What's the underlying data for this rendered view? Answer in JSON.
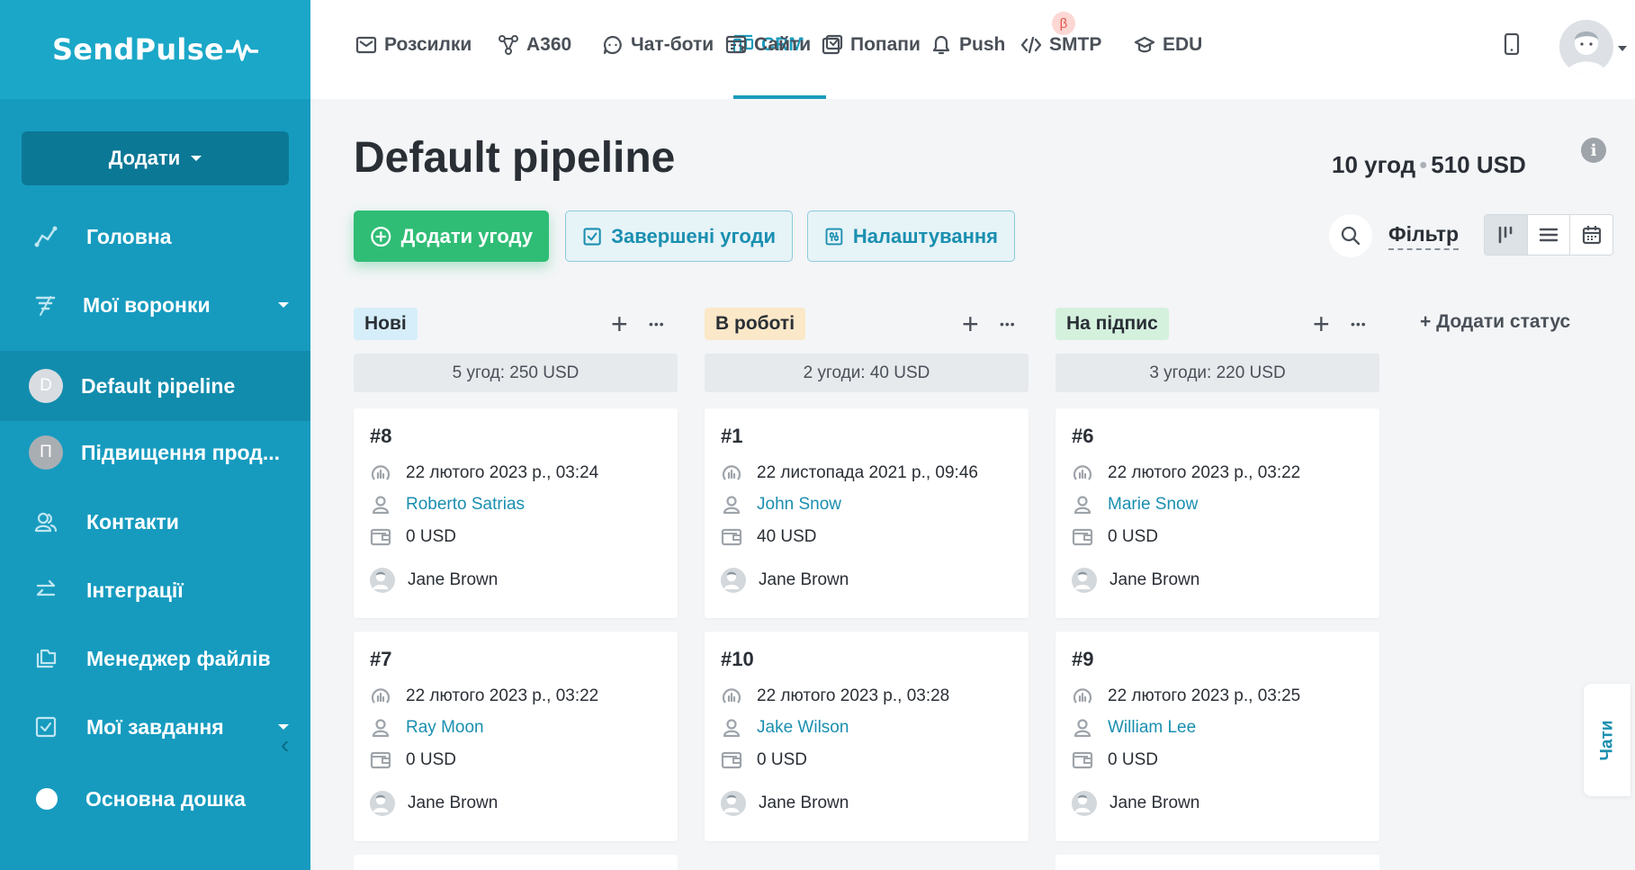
{
  "brand": {
    "name": "SendPulse"
  },
  "sidebar": {
    "add_label": "Додати",
    "items": [
      {
        "label": "Головна",
        "icon": "chart-line-icon"
      },
      {
        "label": "Мої воронки",
        "icon": "funnel-icon"
      },
      {
        "label": "Default pipeline",
        "letter": "D"
      },
      {
        "label": "Підвищення прод...",
        "letter": "П"
      },
      {
        "label": "Контакти",
        "icon": "contacts-icon"
      },
      {
        "label": "Інтеграції",
        "icon": "swap-arrows-icon"
      },
      {
        "label": "Менеджер файлів",
        "icon": "files-icon"
      },
      {
        "label": "Мої завдання",
        "icon": "checkbox-icon"
      },
      {
        "label": "Основна дошка",
        "icon": "white-dot-icon"
      }
    ]
  },
  "topnav": {
    "items": [
      {
        "label": "Розсилки"
      },
      {
        "label": "A360"
      },
      {
        "label": "Чат-боти"
      },
      {
        "label": "CRM"
      },
      {
        "label": "Сайти"
      },
      {
        "label": "Попапи"
      },
      {
        "label": "Push"
      },
      {
        "label": "SMTP"
      },
      {
        "label": "EDU"
      }
    ],
    "beta_label": "β"
  },
  "page": {
    "title": "Default pipeline",
    "deals_count": "10 угод",
    "deals_sum": "510 USD",
    "info_glyph": "i"
  },
  "toolbar": {
    "add_deal": "Додати угоду",
    "completed_deals": "Завершені угоди",
    "settings": "Налаштування",
    "filter": "Фільтр"
  },
  "board": {
    "add_status": "Додати статус",
    "columns": [
      {
        "name": "Нові",
        "color": "#d6eef9",
        "summary": "5 угод: 250 USD",
        "cards": [
          {
            "number": "#8",
            "date": "22 лютого 2023 р., 03:24",
            "contact": "Roberto Satrias",
            "amount": "0 USD",
            "owner": "Jane Brown"
          },
          {
            "number": "#7",
            "date": "22 лютого 2023 р., 03:22",
            "contact": "Ray Moon",
            "amount": "0 USD",
            "owner": "Jane Brown"
          }
        ]
      },
      {
        "name": "В роботі",
        "color": "#fbe8c8",
        "summary": "2 угоди: 40 USD",
        "cards": [
          {
            "number": "#1",
            "date": "22 листопада 2021 р., 09:46",
            "contact": "John Snow",
            "amount": "40 USD",
            "owner": "Jane Brown"
          },
          {
            "number": "#10",
            "date": "22 лютого 2023 р., 03:28",
            "contact": "Jake Wilson",
            "amount": "0 USD",
            "owner": "Jane Brown"
          }
        ]
      },
      {
        "name": "На підпис",
        "color": "#d4f1dd",
        "summary": "3 угоди: 220 USD",
        "cards": [
          {
            "number": "#6",
            "date": "22 лютого 2023 р., 03:22",
            "contact": "Marie Snow",
            "amount": "0 USD",
            "owner": "Jane Brown"
          },
          {
            "number": "#9",
            "date": "22 лютого 2023 р., 03:25",
            "contact": "William Lee",
            "amount": "0 USD",
            "owner": "Jane Brown"
          }
        ]
      }
    ]
  },
  "chat_tab": "Чати",
  "colors": {
    "sidebar": "#169bbf",
    "accent": "#1a9bbd",
    "primary_button": "#2fbd75"
  }
}
